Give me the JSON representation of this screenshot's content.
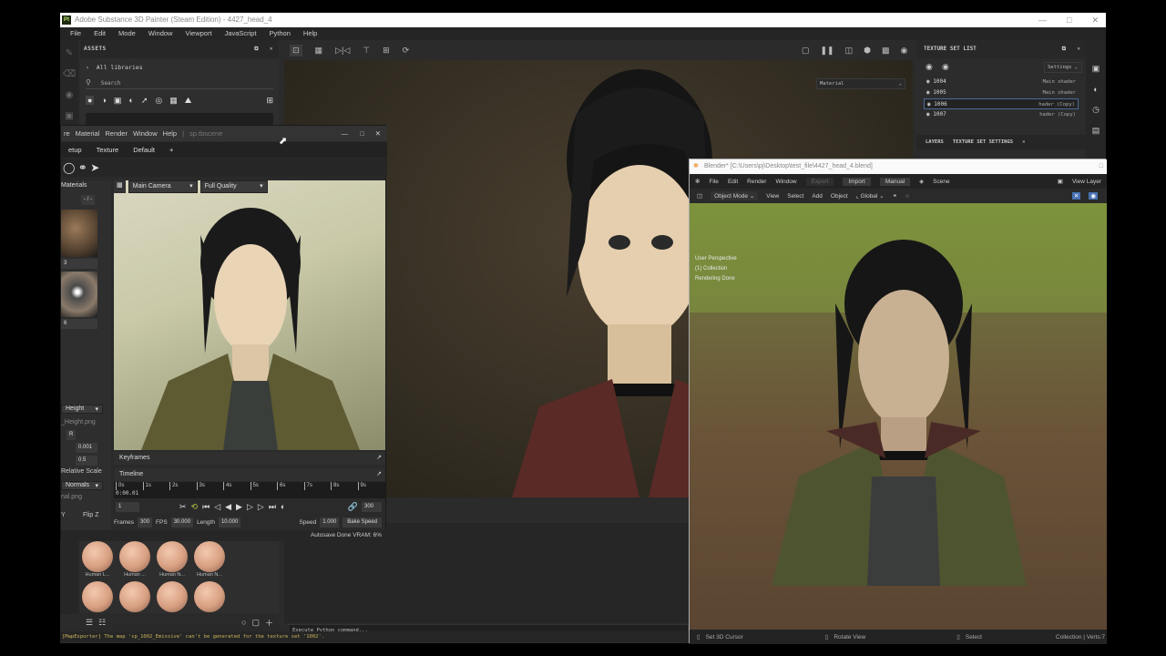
{
  "substance": {
    "title": "Adobe Substance 3D Painter (Steam Edition) - 4427_head_4",
    "logo": "Pt",
    "window_controls": [
      "minimize",
      "maximize",
      "close"
    ],
    "menu": [
      "File",
      "Edit",
      "Mode",
      "Window",
      "Viewport",
      "JavaScript",
      "Python",
      "Help"
    ],
    "assets": {
      "title": "ASSETS",
      "all_libraries": "All libraries",
      "search_placeholder": "Search",
      "skin_labels": [
        "Human L...",
        "Human ...",
        "Human N...",
        "Human N..."
      ]
    },
    "viewport": {
      "material_dropdown": "Material"
    },
    "texture_set_list": {
      "title": "TEXTURE SET LIST",
      "settings_label": "Settings",
      "rows": [
        {
          "name": "1004",
          "shader": "Main shader",
          "selected": false
        },
        {
          "name": "1005",
          "shader": "Main shader",
          "selected": false
        },
        {
          "name": "1006",
          "shader": "hader (Copy)",
          "selected": true
        },
        {
          "name": "1007",
          "shader": "hader (Copy)",
          "selected": false
        }
      ]
    },
    "bottom_tabs": [
      "LAYERS",
      "TEXTURE SET SETTINGS"
    ],
    "console_placeholder": "Execute Python command...",
    "log_message": "[MapExporter] The map 'sp_1002_Emissive' can't be generated for the texture set '1002'."
  },
  "toolbag": {
    "menu": [
      "re",
      "Material",
      "Render",
      "Window",
      "Help",
      "|",
      "sp.tbscene"
    ],
    "tabs": [
      "etup",
      "Texture",
      "Default",
      "+"
    ],
    "materials_label": "Materials",
    "material_counter": "- / -",
    "material_ids": [
      "3",
      "6"
    ],
    "camera": "Main Camera",
    "quality": "Full Quality",
    "props": {
      "height_dropdown": "Height",
      "height_file": "_Height.png",
      "channel": "R",
      "value1": "0.001",
      "value2": "0.5",
      "relative_scale": "Relative Scale",
      "normals_dropdown": "Normals",
      "normal_file": "nal.png",
      "axis_y": "Y",
      "flip_z": "Flip Z"
    },
    "keyframes_label": "Keyframes",
    "timeline_label": "Timeline",
    "ruler_ticks": [
      "0s",
      "1s",
      "2s",
      "3s",
      "4s",
      "5s",
      "6s",
      "7s",
      "8s",
      "9s"
    ],
    "current_time": "0:00.01",
    "current_frame": "1",
    "end_frame": "300",
    "frames_label": "Frames",
    "frames": "300",
    "fps_label": "FPS",
    "fps": "30.000",
    "length_label": "Length",
    "length": "10.000",
    "speed_label": "Speed",
    "speed": "1.000",
    "bake_speed": "Bake Speed",
    "status": "Autosave Done   VRAM: 6%"
  },
  "blender": {
    "title": "Blender* [C:\\Users\\pj\\Desktop\\test_file\\4427_head_4.blend]",
    "menu": [
      "File",
      "Edit",
      "Render",
      "Window"
    ],
    "export": "Export",
    "import": "Import",
    "manual": "Manual",
    "scene": "Scene",
    "view_layer": "View Layer",
    "mode": "Object Mode",
    "header_menu": [
      "View",
      "Select",
      "Add",
      "Object"
    ],
    "orientation": "Global",
    "overlay_info": [
      "User Perspective",
      "(1) Collection",
      "Rendering Done"
    ],
    "status": {
      "left": "Set 3D Cursor",
      "middle": "Rotate View",
      "right": "Select",
      "stats": "Collection | Verts:7"
    }
  }
}
